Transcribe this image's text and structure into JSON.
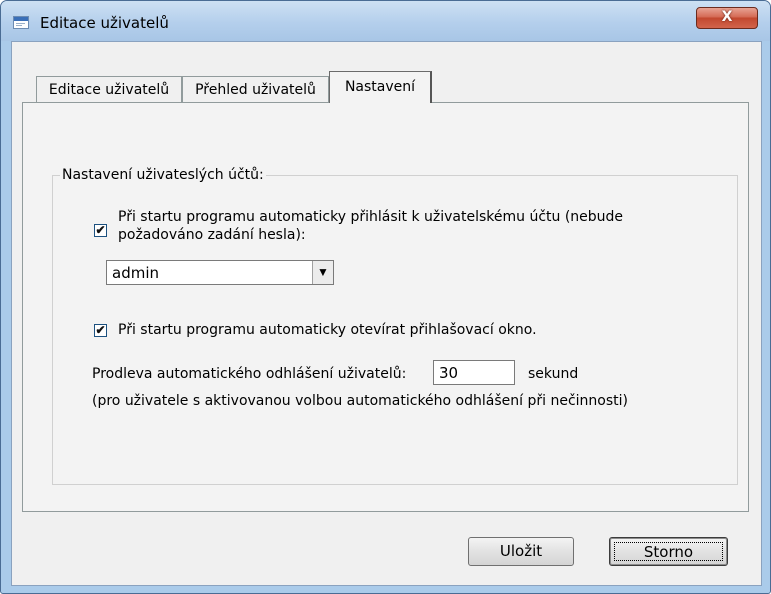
{
  "window": {
    "title": "Editace uživatelů",
    "close_label": "X"
  },
  "tabs": [
    {
      "label": "Editace uživatelů",
      "active": false
    },
    {
      "label": "Přehled uživatelů",
      "active": false
    },
    {
      "label": "Nastavení",
      "active": true
    }
  ],
  "settings": {
    "group_title": "Nastavení uživateslých účtů:",
    "auto_login": {
      "checked": true,
      "check_glyph": "✔",
      "label_line1": "Při startu programu automaticky přihlásit k uživatelskému účtu (nebude",
      "label_line2": "požadováno zadání hesla):"
    },
    "user_select": {
      "value": "admin",
      "arrow_glyph": "▼"
    },
    "auto_open_login": {
      "checked": true,
      "check_glyph": "✔",
      "label": "Při startu programu automaticky otevírat přihlašovací okno."
    },
    "logout_delay": {
      "label": "Prodleva automatického odhlášení uživatelů:",
      "value": "30",
      "unit": "sekund",
      "note": "(pro uživatele s aktivovanou volbou automatického odhlášení při nečinnosti)"
    }
  },
  "buttons": {
    "save": "Uložit",
    "cancel": "Storno"
  },
  "colors": {
    "title_bar": "#b4cfec",
    "close_button": "#c2482f",
    "dialog_background": "#f0f0f0"
  }
}
